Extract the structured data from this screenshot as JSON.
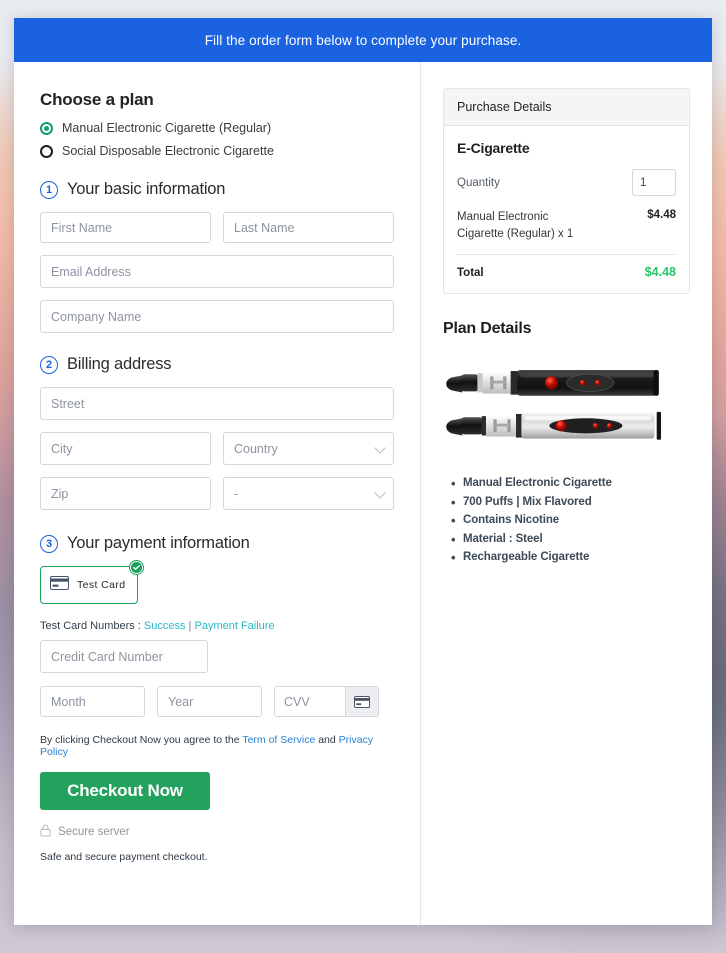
{
  "banner": {
    "text": "Fill the order form below to complete your purchase."
  },
  "plans": {
    "heading": "Choose a plan",
    "options": [
      {
        "label": "Manual Electronic Cigarette (Regular)",
        "selected": true
      },
      {
        "label": "Social Disposable Electronic Cigarette",
        "selected": false
      }
    ]
  },
  "basic_info": {
    "step": "1",
    "title": "Your basic information",
    "first_name_placeholder": "First Name",
    "last_name_placeholder": "Last Name",
    "email_placeholder": "Email Address",
    "company_placeholder": "Company Name"
  },
  "billing": {
    "step": "2",
    "title": "Billing address",
    "street_placeholder": "Street",
    "city_placeholder": "City",
    "country_value": "Country",
    "zip_placeholder": "Zip",
    "state_value": "-"
  },
  "payment": {
    "step": "3",
    "title": "Your payment information",
    "method_label": "Test  Card",
    "test_prefix": "Test Card Numbers : ",
    "test_success": "Success",
    "test_separator": " | ",
    "test_failure": "Payment Failure",
    "card_number_placeholder": "Credit Card Number",
    "month_value": "Month",
    "year_value": "Year",
    "cvv_placeholder": "CVV",
    "terms_prefix": "By clicking Checkout Now you agree to the ",
    "terms_link": "Term of Service",
    "terms_middle": " and ",
    "privacy_link": "Privacy Policy",
    "checkout_label": "Checkout Now",
    "secure_label": "Secure server",
    "safe_note": "Safe and secure payment checkout."
  },
  "purchase": {
    "header": "Purchase Details",
    "product_title": "E-Cigarette",
    "quantity_label": "Quantity",
    "quantity_value": "1",
    "line_item_name": "Manual Electronic Cigarette (Regular) x 1",
    "line_item_price": "$4.48",
    "total_label": "Total",
    "total_value": "$4.48"
  },
  "plan_details": {
    "heading": "Plan Details",
    "features": [
      "Manual Electronic Cigarette",
      "700 Puffs | Mix Flavored",
      "Contains Nicotine",
      "Material : Steel",
      "Rechargeable Cigarette"
    ]
  },
  "colors": {
    "banner_blue": "#1a62e0",
    "accent_green": "#22a25c",
    "total_green": "#2bc46b",
    "link_teal": "#29b7c8",
    "link_blue": "#2b7fd4",
    "step_blue": "#1a62e0"
  }
}
